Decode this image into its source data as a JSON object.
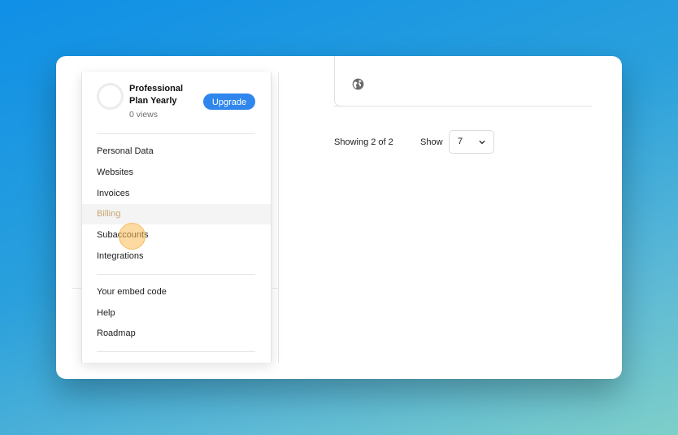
{
  "plan": {
    "name": "Professional Plan Yearly",
    "views": "0 views",
    "upgrade_label": "Upgrade"
  },
  "menu": {
    "items": [
      {
        "label": "Personal Data"
      },
      {
        "label": "Websites"
      },
      {
        "label": "Invoices"
      },
      {
        "label": "Billing",
        "active": true
      },
      {
        "label": "Subaccounts"
      },
      {
        "label": "Integrations"
      }
    ],
    "secondary": [
      {
        "label": "Your embed code"
      },
      {
        "label": "Help"
      },
      {
        "label": "Roadmap"
      }
    ]
  },
  "content": {
    "card_icon": "globe-icon",
    "showing_text": "Showing 2 of 2",
    "show_label": "Show",
    "page_size_value": "7"
  },
  "colors": {
    "accent": "#2f86ec",
    "cursor_highlight": "#fbbc56"
  }
}
